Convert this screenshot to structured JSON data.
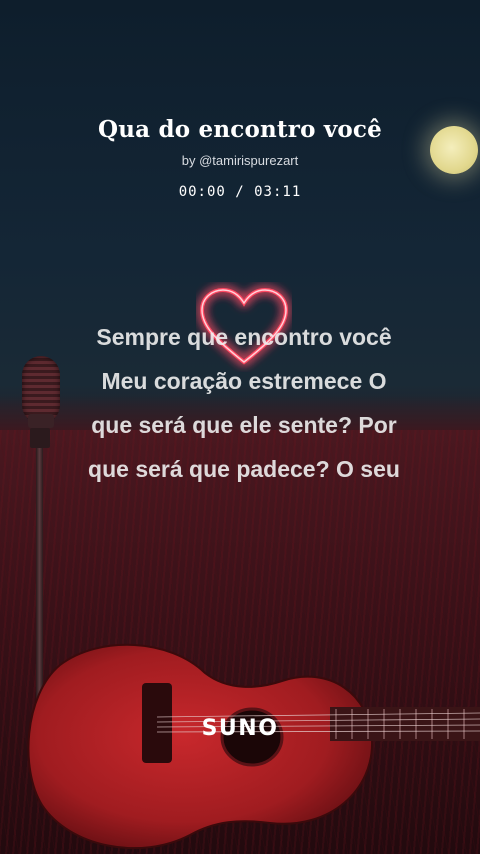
{
  "song": {
    "title": "Qua do encontro você",
    "artist": "by @tamirispurezart",
    "time_display": "00:00 / 03:11"
  },
  "lyrics": {
    "lines": [
      "Sempre que encontro você",
      "Meu coração estremece O",
      "que será que ele sente? Por",
      "que será que padece? O seu"
    ]
  },
  "branding": {
    "logo_text": "SUNO"
  },
  "colors": {
    "heart_neon": "#ff3a55",
    "moon": "#e6dc94",
    "guitar": "#a81e22",
    "sky_top": "#0e1e2c",
    "field": "#3a1118"
  },
  "icons": [
    "heart-icon",
    "moon-icon",
    "microphone-icon",
    "guitar-icon"
  ]
}
